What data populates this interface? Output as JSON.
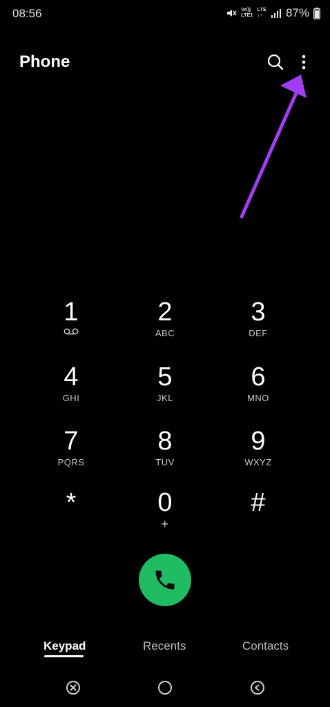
{
  "status_bar": {
    "time": "08:56",
    "volte_line1": "Vo))",
    "volte_line2": "LTE1",
    "lte_line1": "LTE",
    "lte_line2": "↓↑",
    "battery": "87%"
  },
  "header": {
    "title": "Phone"
  },
  "keypad": {
    "keys": [
      {
        "digit": "1",
        "sub": ""
      },
      {
        "digit": "2",
        "sub": "ABC"
      },
      {
        "digit": "3",
        "sub": "DEF"
      },
      {
        "digit": "4",
        "sub": "GHI"
      },
      {
        "digit": "5",
        "sub": "JKL"
      },
      {
        "digit": "6",
        "sub": "MNO"
      },
      {
        "digit": "7",
        "sub": "PQRS"
      },
      {
        "digit": "8",
        "sub": "TUV"
      },
      {
        "digit": "9",
        "sub": "WXYZ"
      },
      {
        "digit": "*",
        "sub": ""
      },
      {
        "digit": "0",
        "sub": "+"
      },
      {
        "digit": "#",
        "sub": ""
      }
    ]
  },
  "tabs": {
    "keypad": "Keypad",
    "recents": "Recents",
    "contacts": "Contacts",
    "active": "keypad"
  },
  "colors": {
    "background": "#000000",
    "call_button": "#1fbc63",
    "annotation_arrow": "#a23ef2"
  },
  "icons": {
    "search": "search-icon",
    "more": "more-vert-icon",
    "call": "phone-icon",
    "voicemail": "voicemail-icon",
    "nav_recent": "recent-apps-icon",
    "nav_home": "home-icon",
    "nav_back": "back-icon"
  }
}
